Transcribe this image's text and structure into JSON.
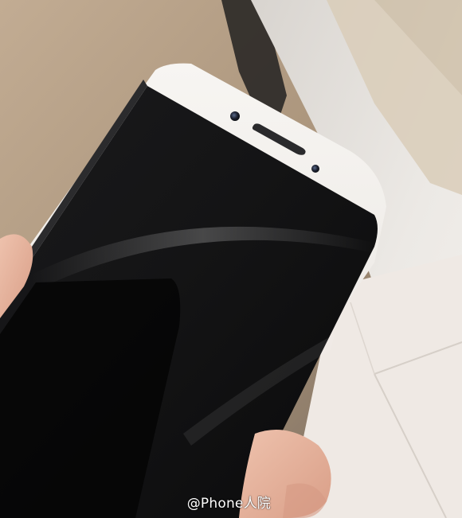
{
  "photo": {
    "subject_icon": "smartphone-front-icon",
    "watermark": "@Phone人院"
  },
  "colors": {
    "background_left": "#b49e86",
    "background_right": "#e6e2dc",
    "phone_bezel": "#f1efec",
    "phone_screen": "#0f0f10",
    "skin": "#e7b6a1",
    "floor": "#efe9e4"
  }
}
